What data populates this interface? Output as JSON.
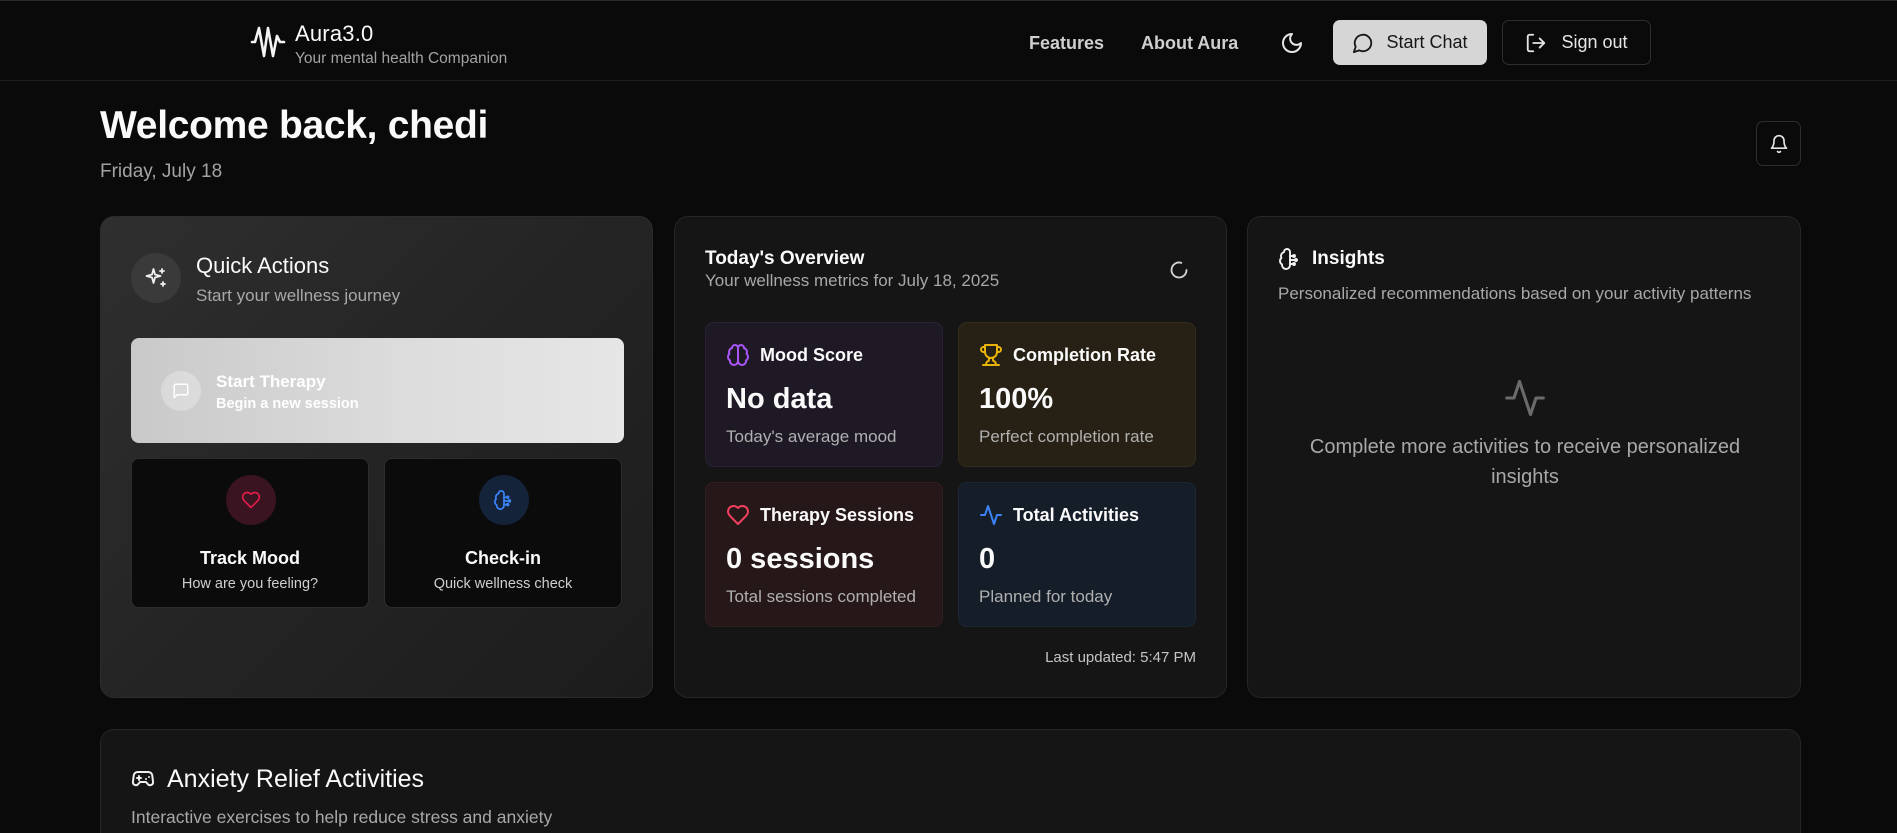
{
  "brand": {
    "name": "Aura3.0",
    "tagline": "Your mental health Companion",
    "logo_icon": "audio-waveform-icon"
  },
  "nav": {
    "features": "Features",
    "about": "About Aura",
    "theme_icon": "moon-icon",
    "start_chat": "Start Chat",
    "sign_out": "Sign out"
  },
  "welcome": {
    "title": "Welcome back, chedi",
    "date": "Friday, July 18",
    "notification_icon": "bell-icon"
  },
  "quick_actions": {
    "title": "Quick Actions",
    "subtitle": "Start your wellness journey",
    "start_therapy": {
      "title": "Start Therapy",
      "subtitle": "Begin a new session"
    },
    "track_mood": {
      "title": "Track Mood",
      "subtitle": "How are you feeling?",
      "color": "#e11d48"
    },
    "check_in": {
      "title": "Check-in",
      "subtitle": "Quick wellness check",
      "color": "#3b82f6"
    }
  },
  "overview": {
    "title": "Today's Overview",
    "subtitle": "Your wellness metrics for July 18, 2025",
    "metrics": [
      {
        "label": "Mood Score",
        "value": "No data",
        "description": "Today's average mood",
        "icon": "brain-icon",
        "color": "#a855f7"
      },
      {
        "label": "Completion Rate",
        "value": "100%",
        "description": "Perfect completion rate",
        "icon": "trophy-icon",
        "color": "#eab308"
      },
      {
        "label": "Therapy Sessions",
        "value": "0 sessions",
        "description": "Total sessions completed",
        "icon": "heart-icon",
        "color": "#f43f5e"
      },
      {
        "label": "Total Activities",
        "value": "0",
        "description": "Planned for today",
        "icon": "activity-icon",
        "color": "#3b82f6"
      }
    ],
    "last_updated": "Last updated: 5:47 PM"
  },
  "insights": {
    "title": "Insights",
    "subtitle": "Personalized recommendations based on your activity patterns",
    "empty_text": "Complete more activities to receive personalized insights"
  },
  "anxiety": {
    "title": "Anxiety Relief Activities",
    "subtitle": "Interactive exercises to help reduce stress and anxiety"
  }
}
